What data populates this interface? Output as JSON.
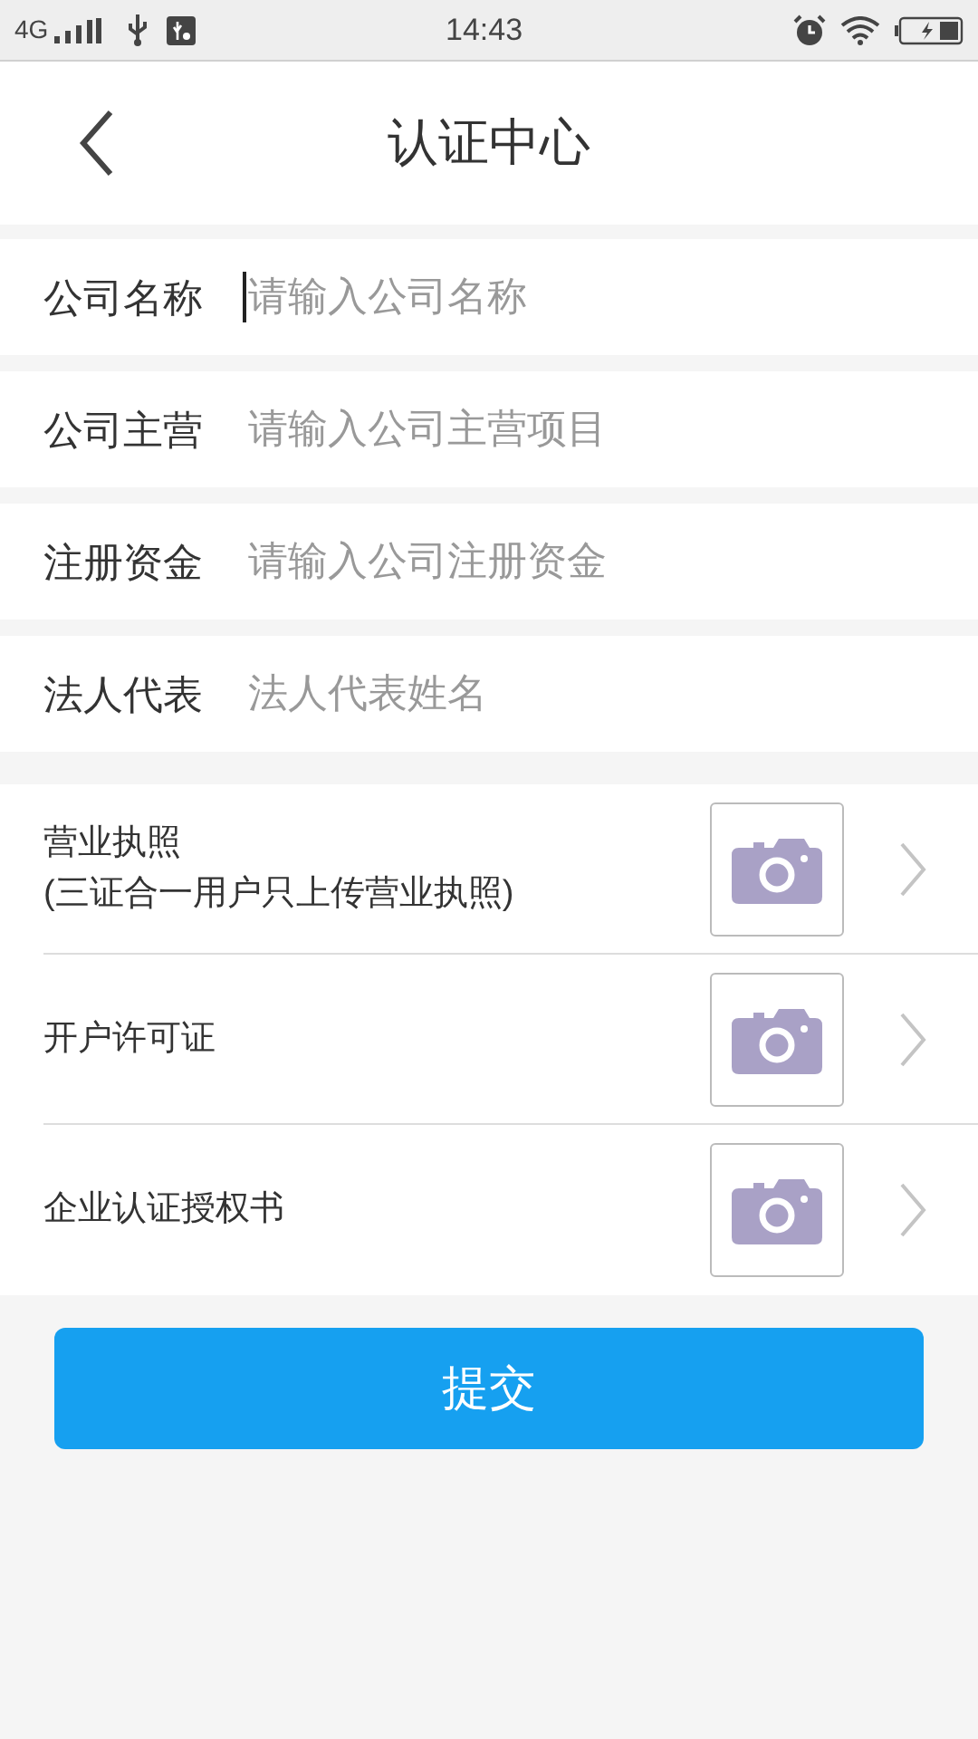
{
  "status_bar": {
    "network": "4G",
    "time": "14:43"
  },
  "header": {
    "title": "认证中心"
  },
  "fields": [
    {
      "label": "公司名称",
      "placeholder": "请输入公司名称",
      "focused": true
    },
    {
      "label": "公司主营",
      "placeholder": "请输入公司主营项目",
      "focused": false
    },
    {
      "label": "注册资金",
      "placeholder": "请输入公司注册资金",
      "focused": false
    },
    {
      "label": "法人代表",
      "placeholder": "法人代表姓名",
      "focused": false
    }
  ],
  "uploads": [
    {
      "label": "营业执照",
      "note": "(三证合一用户只上传营业执照)"
    },
    {
      "label": "开户许可证"
    },
    {
      "label": "企业认证授权书"
    }
  ],
  "submit_button": "提交"
}
